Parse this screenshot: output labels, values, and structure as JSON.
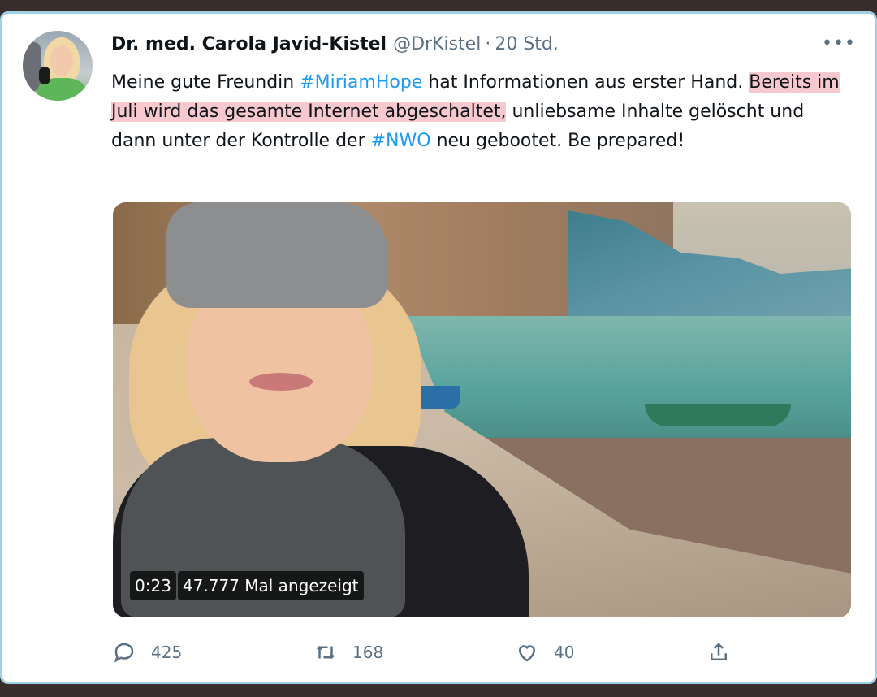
{
  "tweet": {
    "author_name": "Dr. med. Carola Javid-Kistel",
    "handle": "@DrKistel",
    "separator": "·",
    "time": "20 Std.",
    "more_label": "•••",
    "text": {
      "p1": "Meine gute Freundin ",
      "tag1": "#MiriamHope",
      "p2": " hat Informationen aus erster Hand. ",
      "highlight": "Bereits im Juli  wird das gesamte Internet abgeschaltet,",
      "p3": " unliebsame Inhalte gelöscht und dann unter der Kontrolle der ",
      "tag2": "#NWO",
      "p4": " neu gebootet. Be prepared!"
    },
    "video": {
      "duration": "0:23",
      "views": "47.777 Mal angezeigt"
    },
    "actions": {
      "replies": "425",
      "retweets": "168",
      "likes": "40"
    }
  },
  "colors": {
    "link": "#1d9bf0",
    "highlight": "#f7c9cf",
    "secondary_text": "#5b7083"
  }
}
